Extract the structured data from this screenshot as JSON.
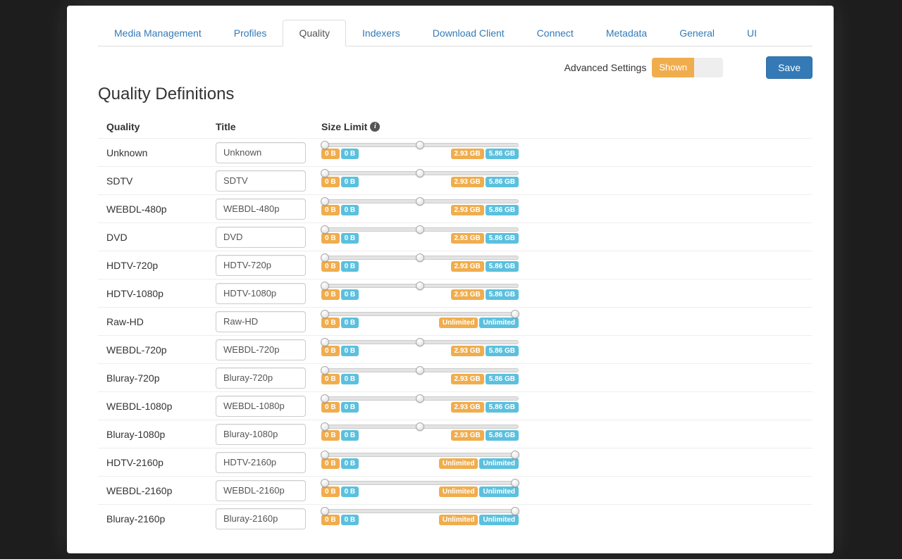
{
  "tabs": [
    {
      "label": "Media Management",
      "active": false
    },
    {
      "label": "Profiles",
      "active": false
    },
    {
      "label": "Quality",
      "active": true
    },
    {
      "label": "Indexers",
      "active": false
    },
    {
      "label": "Download Client",
      "active": false
    },
    {
      "label": "Connect",
      "active": false
    },
    {
      "label": "Metadata",
      "active": false
    },
    {
      "label": "General",
      "active": false
    },
    {
      "label": "UI",
      "active": false
    }
  ],
  "topbar": {
    "advanced_label": "Advanced Settings",
    "toggle_on": "Shown",
    "save": "Save"
  },
  "page": {
    "title": "Quality Definitions"
  },
  "columns": {
    "quality": "Quality",
    "title": "Title",
    "size": "Size Limit"
  },
  "rows": [
    {
      "quality": "Unknown",
      "title": "Unknown",
      "low_a": "0 B",
      "low_b": "0 B",
      "hi_a": "2.93 GB",
      "hi_b": "5.86 GB",
      "handle": "mid"
    },
    {
      "quality": "SDTV",
      "title": "SDTV",
      "low_a": "0 B",
      "low_b": "0 B",
      "hi_a": "2.93 GB",
      "hi_b": "5.86 GB",
      "handle": "mid"
    },
    {
      "quality": "WEBDL-480p",
      "title": "WEBDL-480p",
      "low_a": "0 B",
      "low_b": "0 B",
      "hi_a": "2.93 GB",
      "hi_b": "5.86 GB",
      "handle": "mid"
    },
    {
      "quality": "DVD",
      "title": "DVD",
      "low_a": "0 B",
      "low_b": "0 B",
      "hi_a": "2.93 GB",
      "hi_b": "5.86 GB",
      "handle": "mid"
    },
    {
      "quality": "HDTV-720p",
      "title": "HDTV-720p",
      "low_a": "0 B",
      "low_b": "0 B",
      "hi_a": "2.93 GB",
      "hi_b": "5.86 GB",
      "handle": "mid"
    },
    {
      "quality": "HDTV-1080p",
      "title": "HDTV-1080p",
      "low_a": "0 B",
      "low_b": "0 B",
      "hi_a": "2.93 GB",
      "hi_b": "5.86 GB",
      "handle": "mid"
    },
    {
      "quality": "Raw-HD",
      "title": "Raw-HD",
      "low_a": "0 B",
      "low_b": "0 B",
      "hi_a": "Unlimited",
      "hi_b": "Unlimited",
      "handle": "full"
    },
    {
      "quality": "WEBDL-720p",
      "title": "WEBDL-720p",
      "low_a": "0 B",
      "low_b": "0 B",
      "hi_a": "2.93 GB",
      "hi_b": "5.86 GB",
      "handle": "mid"
    },
    {
      "quality": "Bluray-720p",
      "title": "Bluray-720p",
      "low_a": "0 B",
      "low_b": "0 B",
      "hi_a": "2.93 GB",
      "hi_b": "5.86 GB",
      "handle": "mid"
    },
    {
      "quality": "WEBDL-1080p",
      "title": "WEBDL-1080p",
      "low_a": "0 B",
      "low_b": "0 B",
      "hi_a": "2.93 GB",
      "hi_b": "5.86 GB",
      "handle": "mid"
    },
    {
      "quality": "Bluray-1080p",
      "title": "Bluray-1080p",
      "low_a": "0 B",
      "low_b": "0 B",
      "hi_a": "2.93 GB",
      "hi_b": "5.86 GB",
      "handle": "mid"
    },
    {
      "quality": "HDTV-2160p",
      "title": "HDTV-2160p",
      "low_a": "0 B",
      "low_b": "0 B",
      "hi_a": "Unlimited",
      "hi_b": "Unlimited",
      "handle": "full"
    },
    {
      "quality": "WEBDL-2160p",
      "title": "WEBDL-2160p",
      "low_a": "0 B",
      "low_b": "0 B",
      "hi_a": "Unlimited",
      "hi_b": "Unlimited",
      "handle": "full"
    },
    {
      "quality": "Bluray-2160p",
      "title": "Bluray-2160p",
      "low_a": "0 B",
      "low_b": "0 B",
      "hi_a": "Unlimited",
      "hi_b": "Unlimited",
      "handle": "full"
    }
  ]
}
